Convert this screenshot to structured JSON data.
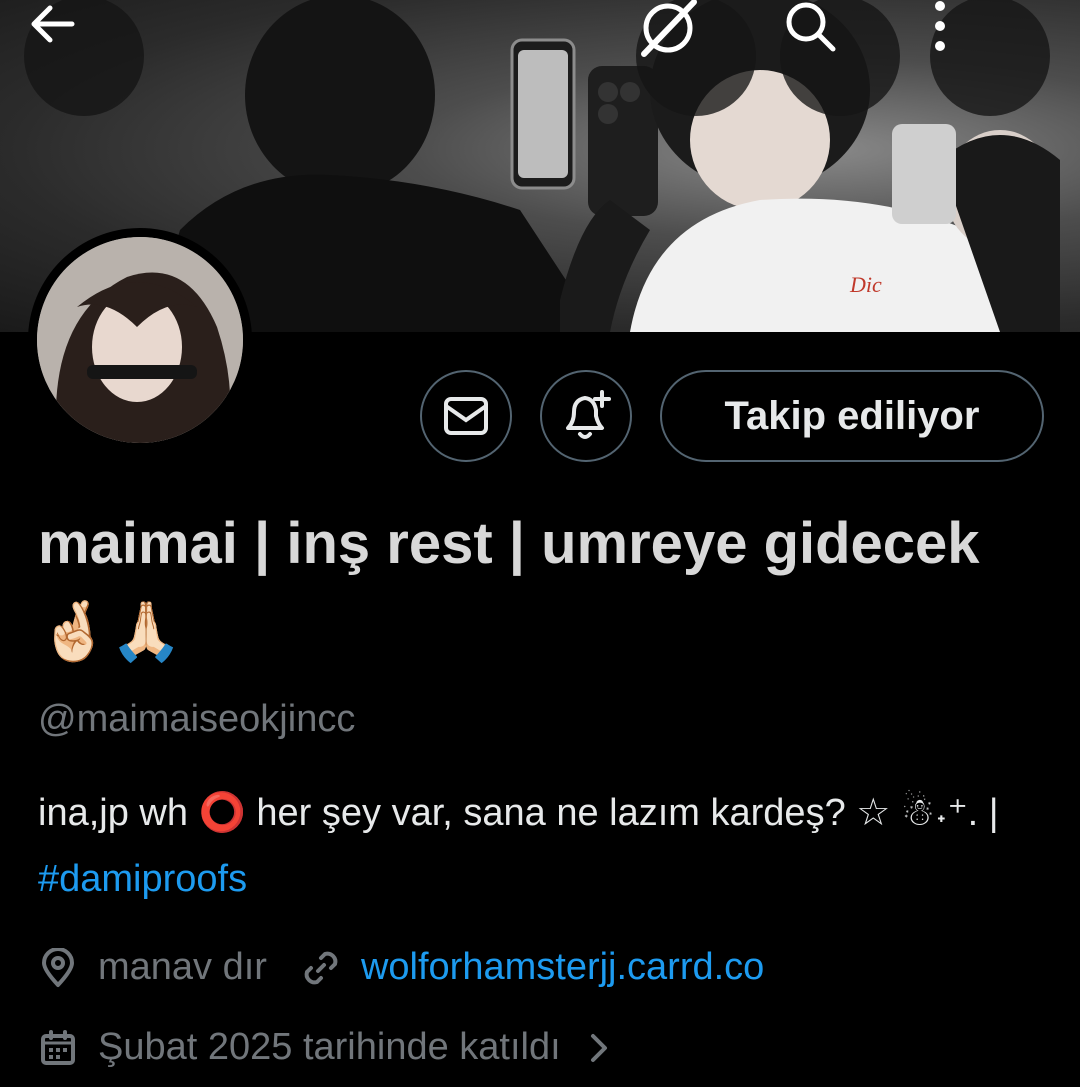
{
  "header": {
    "back_icon": "arrow-left-icon",
    "grok_icon": "grok-icon",
    "search_icon": "search-icon",
    "more_icon": "more-vertical-icon"
  },
  "actions": {
    "message_icon": "envelope-icon",
    "notify_icon": "bell-plus-icon",
    "follow_label": "Takip ediliyor"
  },
  "profile": {
    "display_name": "maimai | inş rest | umreye gidecek 🤞🏻🙏🏻",
    "handle": "@maimaiseokjincc",
    "bio_text": "ina,jp wh ⭕ her şey var, sana ne lazım kardeş? ☆ ☃︎˖⁺. | ",
    "bio_hashtag": "#damiproofs",
    "location": "manav dır",
    "website": "wolforhamsterjj.carrd.co",
    "joined": "Şubat 2025 tarihinde katıldı"
  },
  "colors": {
    "accent": "#1d9bf0",
    "muted": "#71767b",
    "border": "#536471",
    "background": "#000000"
  }
}
